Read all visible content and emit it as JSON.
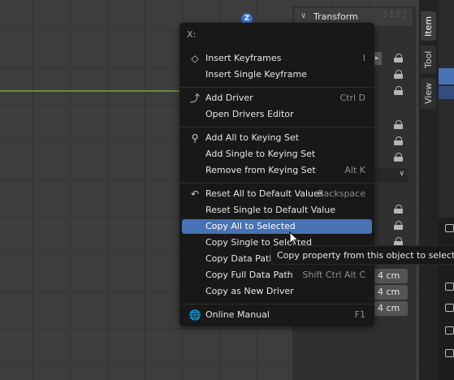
{
  "viewport": {
    "gizmo_axis": "Z"
  },
  "npanel": {
    "header_title": "Transform",
    "tabs": [
      "Item",
      "Tool",
      "View"
    ],
    "active_tab": "Item",
    "dimension_values": [
      "4 cm",
      "4 cm",
      "4 cm"
    ]
  },
  "menu": {
    "title": "X:",
    "groups": [
      [
        {
          "label": "Insert Keyframes",
          "shortcut": "I",
          "icon": "keyframe-add-icon"
        },
        {
          "label": "Insert Single Keyframe",
          "shortcut": "",
          "icon": ""
        }
      ],
      [
        {
          "label": "Add Driver",
          "shortcut": "Ctrl D",
          "icon": "driver-icon"
        },
        {
          "label": "Open Drivers Editor",
          "shortcut": "",
          "icon": ""
        }
      ],
      [
        {
          "label": "Add All to Keying Set",
          "shortcut": "",
          "icon": "keyingset-icon"
        },
        {
          "label": "Add Single to Keying Set",
          "shortcut": "",
          "icon": ""
        },
        {
          "label": "Remove from Keying Set",
          "shortcut": "Alt K",
          "icon": ""
        }
      ],
      [
        {
          "label": "Reset All to Default Values",
          "shortcut": "Backspace",
          "icon": "loop-back-icon"
        },
        {
          "label": "Reset Single to Default Value",
          "shortcut": "",
          "icon": ""
        },
        {
          "label": "Copy All to Selected",
          "shortcut": "",
          "icon": "",
          "highlighted": true
        },
        {
          "label": "Copy Single to Selected",
          "shortcut": "",
          "icon": ""
        },
        {
          "label": "Copy Data Path",
          "shortcut": "",
          "icon": ""
        },
        {
          "label": "Copy Full Data Path",
          "shortcut": "Shift Ctrl Alt C",
          "icon": ""
        },
        {
          "label": "Copy as New Driver",
          "shortcut": "",
          "icon": ""
        }
      ],
      [
        {
          "label": "Online Manual",
          "shortcut": "F1",
          "icon": "globe-icon"
        }
      ]
    ]
  },
  "tooltip": {
    "text": "Copy property from this object to selected objects or bones"
  },
  "colors": {
    "highlight": "#4772b3",
    "menu_bg": "#181818",
    "viewport_bg": "#3d3d3d",
    "x_axis": "#6a8a3c"
  }
}
